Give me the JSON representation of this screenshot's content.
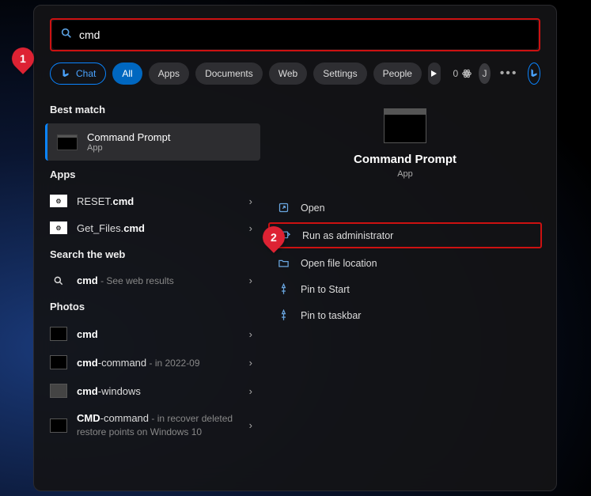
{
  "callouts": {
    "one": "1",
    "two": "2"
  },
  "search": {
    "value": "cmd"
  },
  "tabs": {
    "chat": "Chat",
    "all": "All",
    "apps": "Apps",
    "documents": "Documents",
    "web": "Web",
    "settings": "Settings",
    "people": "People"
  },
  "header_right": {
    "atom_count": "0",
    "user_initial": "J"
  },
  "sections": {
    "best": "Best match",
    "apps": "Apps",
    "web": "Search the web",
    "photos": "Photos"
  },
  "best": {
    "title": "Command Prompt",
    "sub": "App"
  },
  "apps_list": [
    {
      "pre": "RESET.",
      "bold": "cmd"
    },
    {
      "pre": "Get_Files.",
      "bold": "cmd"
    }
  ],
  "web_row": {
    "bold": "cmd",
    "suffix": " - See web results"
  },
  "photos_list": [
    {
      "bold": "cmd",
      "suffix": ""
    },
    {
      "bold": "cmd",
      "mid": "-command",
      "suffix": " - in 2022-09"
    },
    {
      "bold": "cmd",
      "mid": "-windows",
      "suffix": ""
    },
    {
      "bold": "CMD",
      "mid": "-command",
      "suffix": " - in recover deleted restore points on Windows 10"
    }
  ],
  "preview": {
    "title": "Command Prompt",
    "sub": "App"
  },
  "actions": {
    "open": "Open",
    "run_admin": "Run as administrator",
    "open_loc": "Open file location",
    "pin_start": "Pin to Start",
    "pin_task": "Pin to taskbar"
  }
}
